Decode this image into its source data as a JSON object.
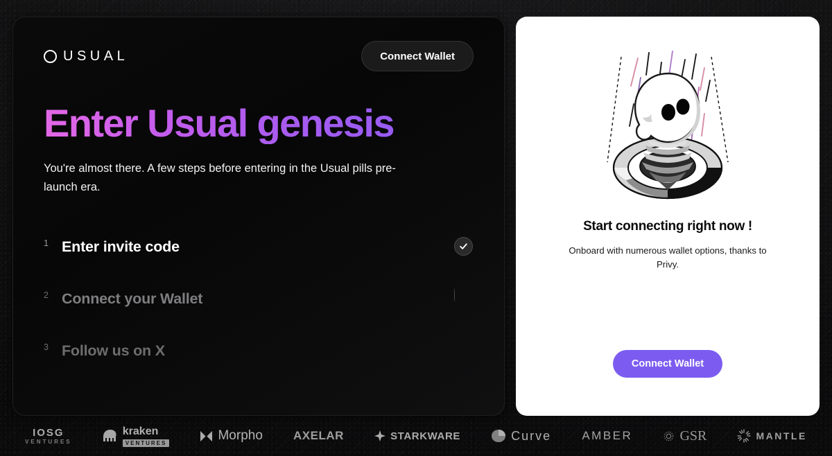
{
  "brand": {
    "logo_mark": "circle-o",
    "logo_text": "USUAL"
  },
  "header": {
    "connect_label": "Connect Wallet"
  },
  "hero": {
    "headline": "Enter Usual genesis",
    "subhead": "You're almost there. A few steps before entering in the Usual pills pre-launch era.",
    "gradient_from": "#e468e6",
    "gradient_to": "#8b5cf6"
  },
  "steps": [
    {
      "num": "1",
      "label": "Enter invite code",
      "state": "done",
      "icon": "check-icon"
    },
    {
      "num": "2",
      "label": "Connect your Wallet",
      "state": "pending",
      "icon": "spinner-icon"
    },
    {
      "num": "3",
      "label": "Follow us on X",
      "state": "todo",
      "icon": "none"
    }
  ],
  "panel": {
    "illustration": "blob-emerging-from-portal-illustration",
    "title": "Start connecting right now !",
    "subtitle": "Onboard with numerous wallet options, thanks to Privy.",
    "cta_label": "Connect Wallet",
    "cta_color": "#7c5cf0"
  },
  "footer": {
    "partners": [
      {
        "name": "IOSG",
        "sub": "VENTURES",
        "kind": "text-stack"
      },
      {
        "name": "kraken",
        "sub": "VENTURES",
        "kind": "kraken"
      },
      {
        "name": "Morpho",
        "sub": "",
        "kind": "morpho"
      },
      {
        "name": "AXELAR",
        "sub": "",
        "kind": "axelar"
      },
      {
        "name": "STARKWARE",
        "sub": "",
        "kind": "starkware"
      },
      {
        "name": "Curve",
        "sub": "",
        "kind": "curve"
      },
      {
        "name": "AMBER",
        "sub": "",
        "kind": "amber"
      },
      {
        "name": "GSR",
        "sub": "",
        "kind": "gsr"
      },
      {
        "name": "MANTLE",
        "sub": "",
        "kind": "mantle"
      }
    ]
  }
}
